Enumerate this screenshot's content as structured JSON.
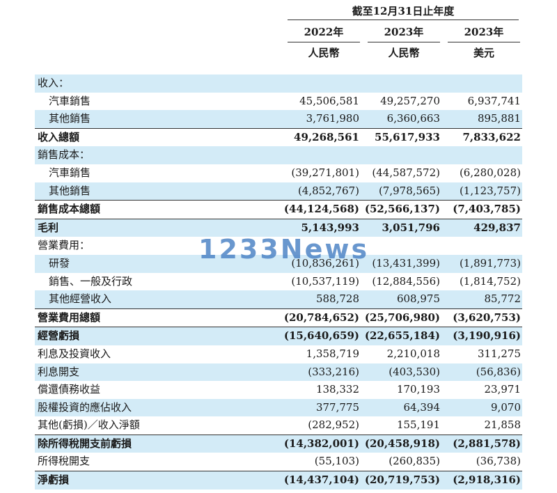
{
  "header": {
    "period": "截至12月31日止年度",
    "columns": [
      {
        "year": "2022年",
        "currency": "人民幣"
      },
      {
        "year": "2023年",
        "currency": "人民幣"
      },
      {
        "year": "2023年",
        "currency": "美元"
      }
    ]
  },
  "rows": [
    {
      "label": "收入：",
      "values": [
        "",
        "",
        ""
      ]
    },
    {
      "label": "汽車銷售",
      "values": [
        "45,506,581",
        "49,257,270",
        "6,937,741"
      ]
    },
    {
      "label": "其他銷售",
      "values": [
        "3,761,980",
        "6,360,663",
        "895,881"
      ]
    },
    {
      "label": "收入總額",
      "values": [
        "49,268,561",
        "55,617,933",
        "7,833,622"
      ]
    },
    {
      "label": "銷售成本：",
      "values": [
        "",
        "",
        ""
      ]
    },
    {
      "label": "汽車銷售",
      "values": [
        "(39,271,801)",
        "(44,587,572)",
        "(6,280,028)"
      ]
    },
    {
      "label": "其他銷售",
      "values": [
        "(4,852,767)",
        "(7,978,565)",
        "(1,123,757)"
      ]
    },
    {
      "label": "銷售成本總額",
      "values": [
        "(44,124,568)",
        "(52,566,137)",
        "(7,403,785)"
      ]
    },
    {
      "label": "毛利",
      "values": [
        "5,143,993",
        "3,051,796",
        "429,837"
      ]
    },
    {
      "label": "營業費用：",
      "values": [
        "",
        "",
        ""
      ]
    },
    {
      "label": "研發",
      "values": [
        "(10,836,261)",
        "(13,431,399)",
        "(1,891,773)"
      ]
    },
    {
      "label": "銷售、一般及行政",
      "values": [
        "(10,537,119)",
        "(12,884,556)",
        "(1,814,752)"
      ]
    },
    {
      "label": "其他經營收入",
      "values": [
        "588,728",
        "608,975",
        "85,772"
      ]
    },
    {
      "label": "營業費用總額",
      "values": [
        "(20,784,652)",
        "(25,706,980)",
        "(3,620,753)"
      ]
    },
    {
      "label": "經營虧損",
      "values": [
        "(15,640,659)",
        "(22,655,184)",
        "(3,190,916)"
      ]
    },
    {
      "label": "利息及投資收入",
      "values": [
        "1,358,719",
        "2,210,018",
        "311,275"
      ]
    },
    {
      "label": "利息開支",
      "values": [
        "(333,216)",
        "(403,530)",
        "(56,836)"
      ]
    },
    {
      "label": "償還債務收益",
      "values": [
        "138,332",
        "170,193",
        "23,971"
      ]
    },
    {
      "label": "股權投資的應佔收入",
      "values": [
        "377,775",
        "64,394",
        "9,070"
      ]
    },
    {
      "label": "其他(虧損)／收入淨額",
      "values": [
        "(282,952)",
        "155,191",
        "21,858"
      ]
    },
    {
      "label": "除所得稅開支前虧損",
      "values": [
        "(14,382,001)",
        "(20,458,918)",
        "(2,881,578)"
      ]
    },
    {
      "label": "所得稅開支",
      "values": [
        "(55,103)",
        "(260,835)",
        "(36,738)"
      ]
    },
    {
      "label": "淨虧損",
      "values": [
        "(14,437,104)",
        "(20,719,753)",
        "(2,918,316)"
      ]
    }
  ],
  "watermark": "1233News"
}
